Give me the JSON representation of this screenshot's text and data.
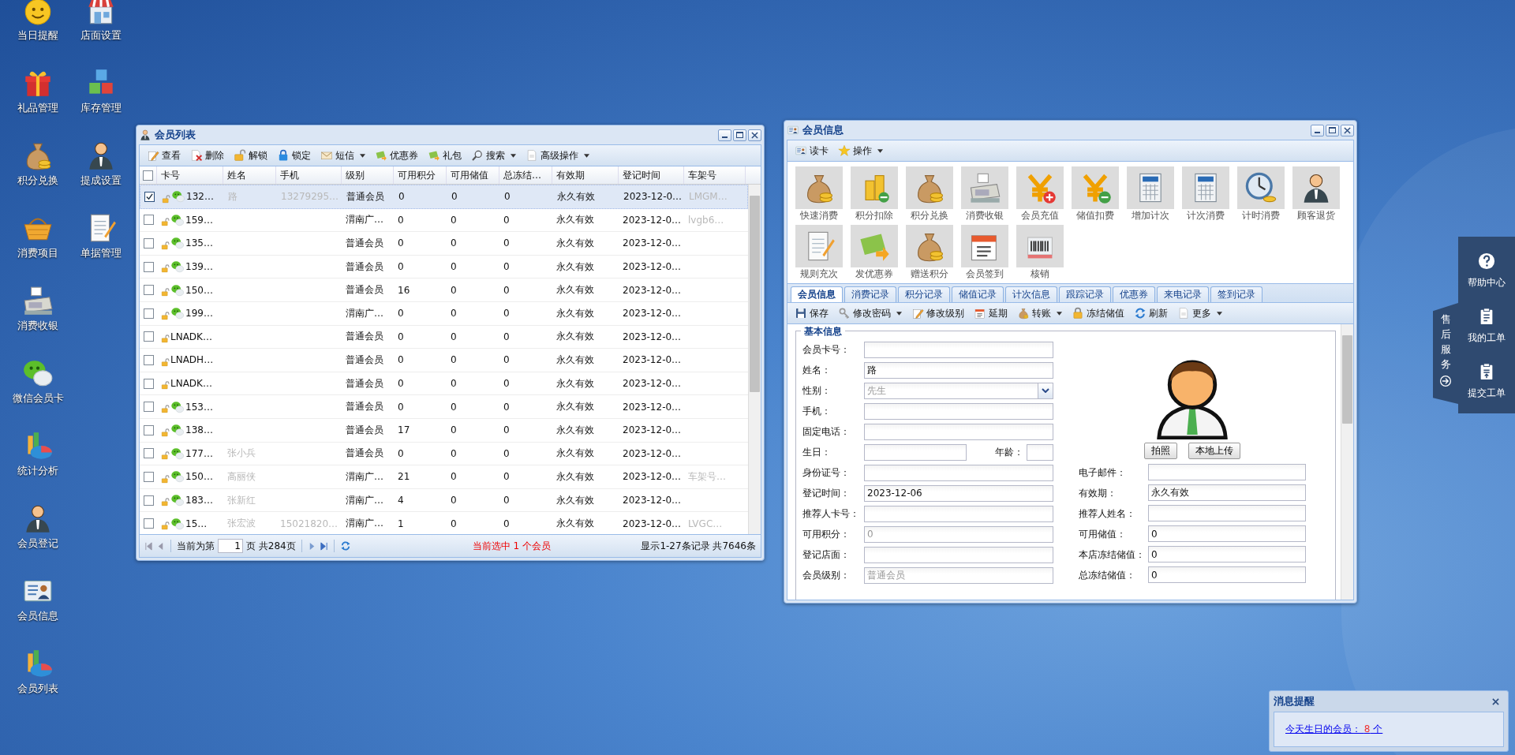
{
  "desktop_icons": [
    {
      "label": "当日提醒"
    },
    {
      "label": "店面设置"
    },
    {
      "label": "礼品管理"
    },
    {
      "label": "库存管理"
    },
    {
      "label": "积分兑换"
    },
    {
      "label": "提成设置"
    },
    {
      "label": "消费项目"
    },
    {
      "label": "单据管理"
    },
    {
      "label": "消费收银"
    },
    {
      "label": "微信会员卡"
    },
    {
      "label": "统计分析"
    },
    {
      "label": "会员登记"
    },
    {
      "label": "会员信息"
    },
    {
      "label": "会员列表"
    }
  ],
  "member_list_window": {
    "title": "会员列表",
    "toolbar": [
      {
        "label": "查看",
        "dropdown": false
      },
      {
        "label": "删除",
        "dropdown": false
      },
      {
        "label": "解锁",
        "dropdown": false
      },
      {
        "label": "锁定",
        "dropdown": false
      },
      {
        "label": "短信",
        "dropdown": true
      },
      {
        "label": "优惠券",
        "dropdown": false
      },
      {
        "label": "礼包",
        "dropdown": false
      },
      {
        "label": "搜索",
        "dropdown": true
      },
      {
        "label": "高级操作",
        "dropdown": true
      }
    ],
    "select_all_checked": false,
    "columns": [
      "卡号",
      "姓名",
      "手机",
      "级别",
      "可用积分",
      "可用储值",
      "总冻结…",
      "有效期",
      "登记时间",
      "车架号"
    ],
    "rows": [
      {
        "checked": true,
        "selected": true,
        "wechat": true,
        "card_no": "132…",
        "name": "路",
        "phone": "13279295…",
        "level": "普通会员",
        "points": "0",
        "stored_value": "0",
        "frozen": "0",
        "validity": "永久有效",
        "registered": "2023-12-0…",
        "frame_no": "LMGM…"
      },
      {
        "checked": false,
        "selected": false,
        "wechat": true,
        "card_no": "159…",
        "level": "渭南广…",
        "points": "0",
        "stored_value": "0",
        "frozen": "0",
        "validity": "永久有效",
        "registered": "2023-12-0…",
        "frame_no": "lvgb6…"
      },
      {
        "checked": false,
        "selected": false,
        "wechat": true,
        "card_no": "135…",
        "level": "普通会员",
        "points": "0",
        "stored_value": "0",
        "frozen": "0",
        "validity": "永久有效",
        "registered": "2023-12-0…"
      },
      {
        "checked": false,
        "selected": false,
        "wechat": true,
        "card_no": "139…",
        "level": "普通会员",
        "points": "0",
        "stored_value": "0",
        "frozen": "0",
        "validity": "永久有效",
        "registered": "2023-12-0…"
      },
      {
        "checked": false,
        "selected": false,
        "wechat": true,
        "card_no": "150…",
        "level": "普通会员",
        "points": "16",
        "stored_value": "0",
        "frozen": "0",
        "validity": "永久有效",
        "registered": "2023-12-0…"
      },
      {
        "checked": false,
        "selected": false,
        "wechat": true,
        "card_no": "199…",
        "level": "渭南广…",
        "points": "0",
        "stored_value": "0",
        "frozen": "0",
        "validity": "永久有效",
        "registered": "2023-12-0…"
      },
      {
        "checked": false,
        "selected": false,
        "wechat": false,
        "card_no": "LNADK…",
        "level": "普通会员",
        "points": "0",
        "stored_value": "0",
        "frozen": "0",
        "validity": "永久有效",
        "registered": "2023-12-0…"
      },
      {
        "checked": false,
        "selected": false,
        "wechat": false,
        "card_no": "LNADH…",
        "level": "普通会员",
        "points": "0",
        "stored_value": "0",
        "frozen": "0",
        "validity": "永久有效",
        "registered": "2023-12-0…"
      },
      {
        "checked": false,
        "selected": false,
        "wechat": false,
        "card_no": "LNADK…",
        "level": "普通会员",
        "points": "0",
        "stored_value": "0",
        "frozen": "0",
        "validity": "永久有效",
        "registered": "2023-12-0…"
      },
      {
        "checked": false,
        "selected": false,
        "wechat": true,
        "card_no": "153…",
        "level": "普通会员",
        "points": "0",
        "stored_value": "0",
        "frozen": "0",
        "validity": "永久有效",
        "registered": "2023-12-0…"
      },
      {
        "checked": false,
        "selected": false,
        "wechat": true,
        "card_no": "138…",
        "level": "普通会员",
        "points": "17",
        "stored_value": "0",
        "frozen": "0",
        "validity": "永久有效",
        "registered": "2023-12-0…"
      },
      {
        "checked": false,
        "selected": false,
        "wechat": true,
        "card_no": "177…",
        "name": "张小兵",
        "level": "普通会员",
        "points": "0",
        "stored_value": "0",
        "frozen": "0",
        "validity": "永久有效",
        "registered": "2023-12-0…"
      },
      {
        "checked": false,
        "selected": false,
        "wechat": true,
        "card_no": "150…",
        "name": "高丽侠",
        "level": "渭南广…",
        "points": "21",
        "stored_value": "0",
        "frozen": "0",
        "validity": "永久有效",
        "registered": "2023-12-0…",
        "frame_no": "车架号…"
      },
      {
        "checked": false,
        "selected": false,
        "wechat": true,
        "card_no": "183…",
        "name": "张新红",
        "level": "渭南广…",
        "points": "4",
        "stored_value": "0",
        "frozen": "0",
        "validity": "永久有效",
        "registered": "2023-12-0…"
      },
      {
        "checked": false,
        "selected": false,
        "wechat": true,
        "card_no": "15…",
        "name": "张宏波",
        "phone": "15021820…",
        "level": "渭南广…",
        "points": "1",
        "stored_value": "0",
        "frozen": "0",
        "validity": "永久有效",
        "registered": "2023-12-0…",
        "frame_no": "LVGC…"
      }
    ],
    "pager": {
      "prefix": "当前为第",
      "page": "1",
      "suffix": "页 共284页"
    },
    "selection_note": "当前选中 1 个会员",
    "record_count": "显示1-27条记录 共7646条"
  },
  "member_info_window": {
    "title": "会员信息",
    "toolbar": [
      {
        "label": "读卡",
        "dropdown": false
      },
      {
        "label": "操作",
        "dropdown": true
      }
    ],
    "functions": [
      {
        "label": "快速消费"
      },
      {
        "label": "积分扣除"
      },
      {
        "label": "积分兑换"
      },
      {
        "label": "消费收银"
      },
      {
        "label": "会员充值"
      },
      {
        "label": "储值扣费"
      },
      {
        "label": "增加计次"
      },
      {
        "label": "计次消费"
      },
      {
        "label": "计时消费"
      },
      {
        "label": "顾客退货"
      },
      {
        "label": "规则充次"
      },
      {
        "label": "发优惠券"
      },
      {
        "label": "赠送积分"
      },
      {
        "label": "会员签到"
      },
      {
        "label": "核销"
      }
    ],
    "tabs": [
      {
        "label": "会员信息",
        "selected": true
      },
      {
        "label": "消费记录",
        "selected": false
      },
      {
        "label": "积分记录",
        "selected": false
      },
      {
        "label": "储值记录",
        "selected": false
      },
      {
        "label": "计次信息",
        "selected": false
      },
      {
        "label": "跟踪记录",
        "selected": false
      },
      {
        "label": "优惠券",
        "selected": false
      },
      {
        "label": "来电记录",
        "selected": false
      },
      {
        "label": "签到记录",
        "selected": false
      }
    ],
    "tab_toolbar": [
      {
        "label": "保存",
        "dropdown": false
      },
      {
        "label": "修改密码",
        "dropdown": true
      },
      {
        "label": "修改级别",
        "dropdown": false
      },
      {
        "label": "延期",
        "dropdown": false
      },
      {
        "label": "转账",
        "dropdown": true
      },
      {
        "label": "冻结储值",
        "dropdown": false
      },
      {
        "label": "刷新",
        "dropdown": false
      },
      {
        "label": "更多",
        "dropdown": true
      }
    ],
    "section_title": "基本信息",
    "photo_buttons": [
      "拍照",
      "本地上传"
    ],
    "left_fields": [
      {
        "kind": "text",
        "label": "会员卡号："
      },
      {
        "kind": "text",
        "label": "姓名：",
        "value": "路",
        "readonly": false
      },
      {
        "kind": "select",
        "label": "性别：",
        "value": "先生",
        "readonly": true
      },
      {
        "kind": "text",
        "label": "手机："
      },
      {
        "kind": "text",
        "label": "固定电话："
      },
      {
        "kind": "date_age",
        "label": "生日：",
        "second_label": "年龄："
      },
      {
        "kind": "text",
        "label": "身份证号："
      },
      {
        "kind": "text",
        "label": "登记时间：",
        "value": "2023-12-06",
        "readonly": false
      },
      {
        "kind": "text",
        "label": "推荐人卡号："
      },
      {
        "kind": "text",
        "label": "可用积分：",
        "value": "0",
        "readonly": true
      },
      {
        "kind": "text",
        "label": "登记店面："
      },
      {
        "kind": "text",
        "label": "会员级别：",
        "value": "普通会员",
        "readonly": true
      }
    ],
    "right_fields": [
      {
        "label": "电子邮件："
      },
      {
        "label": "有效期：",
        "value": "永久有效"
      },
      {
        "label": "推荐人姓名："
      },
      {
        "label": "可用储值：",
        "value": "0"
      },
      {
        "label": "本店冻结储值：",
        "value": "0"
      },
      {
        "label": "总冻结储值：",
        "value": "0"
      }
    ]
  },
  "service_panel": {
    "tab_label": "售后服务",
    "items": [
      {
        "label": "帮助中心"
      },
      {
        "label": "我的工单"
      },
      {
        "label": "提交工单"
      }
    ]
  },
  "notification": {
    "title": "消息提醒",
    "link_text": "今天生日的会员：",
    "count": "8",
    "unit": "个"
  }
}
